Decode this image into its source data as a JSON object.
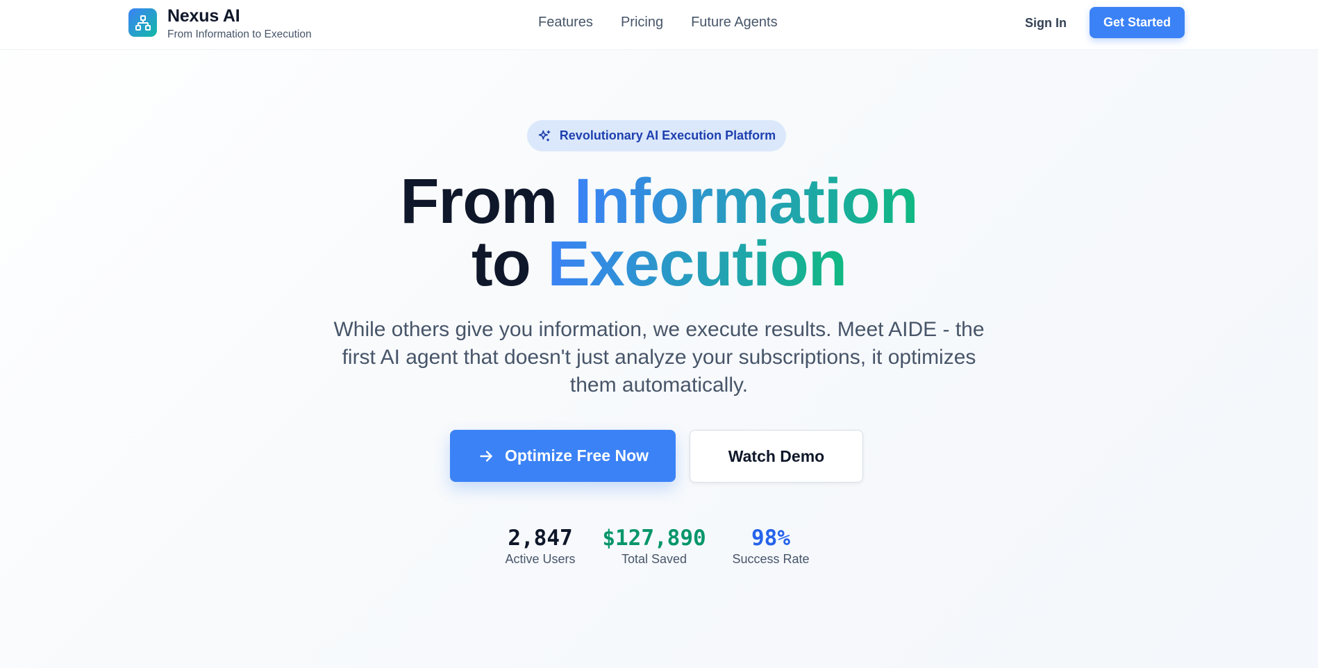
{
  "brand": {
    "name": "Nexus AI",
    "tagline": "From Information to Execution"
  },
  "nav": {
    "items": [
      {
        "label": "Features"
      },
      {
        "label": "Pricing"
      },
      {
        "label": "Future Agents"
      }
    ],
    "sign_in": "Sign In",
    "get_started": "Get Started"
  },
  "hero": {
    "badge": "Revolutionary AI Execution Platform",
    "headline": {
      "line1_plain": "From ",
      "line1_accent": "Information",
      "line2_plain": "to ",
      "line2_accent": "Execution"
    },
    "subtext": "While others give you information, we execute results. Meet AIDE - the first AI agent that doesn't just analyze your subscriptions, it optimizes them automatically.",
    "primary_cta": "Optimize Free Now",
    "secondary_cta": "Watch Demo"
  },
  "stats": [
    {
      "value": "2,847",
      "label": "Active Users",
      "color": "#0f172a"
    },
    {
      "value": "$127,890",
      "label": "Total Saved",
      "color": "#059669"
    },
    {
      "value": "98%",
      "label": "Success Rate",
      "color": "#2563eb"
    }
  ],
  "colors": {
    "primary": "#3b82f6",
    "accent_gradient_start": "#3b82f6",
    "accent_gradient_end": "#10b981",
    "badge_bg": "#dbe8fb",
    "badge_text": "#1e40af"
  },
  "icons": {
    "logo": "network-diagram-icon",
    "badge": "sparkles-icon",
    "cta": "arrow-right-icon"
  }
}
